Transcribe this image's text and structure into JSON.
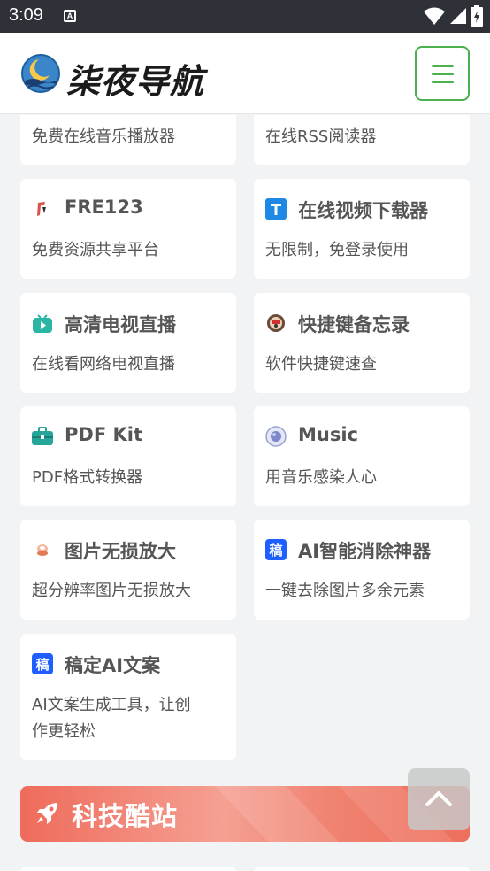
{
  "statusbar": {
    "time": "3:09",
    "a_badge": "A"
  },
  "header": {
    "logo_text": "柒夜导航"
  },
  "cards_top": [
    {
      "desc": "免费在线音乐播放器"
    },
    {
      "desc": "在线RSS阅读器"
    }
  ],
  "cards": [
    {
      "title": "FRE123",
      "desc": "免费资源共享平台",
      "icon": "fre123-icon"
    },
    {
      "title": "在线视频下载器",
      "desc": "无限制，免登录使用",
      "icon": "t-logo-icon"
    },
    {
      "title": "高清电视直播",
      "desc": "在线看网络电视直播",
      "icon": "tv-icon"
    },
    {
      "title": "快捷键备忘录",
      "desc": "软件快捷键速查",
      "icon": "keyboard-icon"
    },
    {
      "title": "PDF Kit",
      "desc": "PDF格式转换器",
      "icon": "briefcase-icon"
    },
    {
      "title": "Music",
      "desc": "用音乐感染人心",
      "icon": "globe-icon"
    },
    {
      "title": "图片无损放大",
      "desc": "超分辨率图片无损放大",
      "icon": "image-enlarge-icon"
    },
    {
      "title": "AI智能消除神器",
      "desc": "一键去除图片多余元素",
      "icon": "gaoding-icon"
    },
    {
      "title": "稿定AI文案",
      "desc": "AI文案生成工具，让创作更轻松",
      "desc_line1": "AI文案生成工具，让创",
      "desc_line2": "作更轻松",
      "icon": "gaoding-icon"
    }
  ],
  "banner": {
    "title": "科技酷站",
    "icon": "rocket-icon"
  },
  "colors": {
    "accent_green": "#4caf50",
    "banner_red": "#ef6b5b",
    "gaoding_blue": "#1f5fff"
  }
}
